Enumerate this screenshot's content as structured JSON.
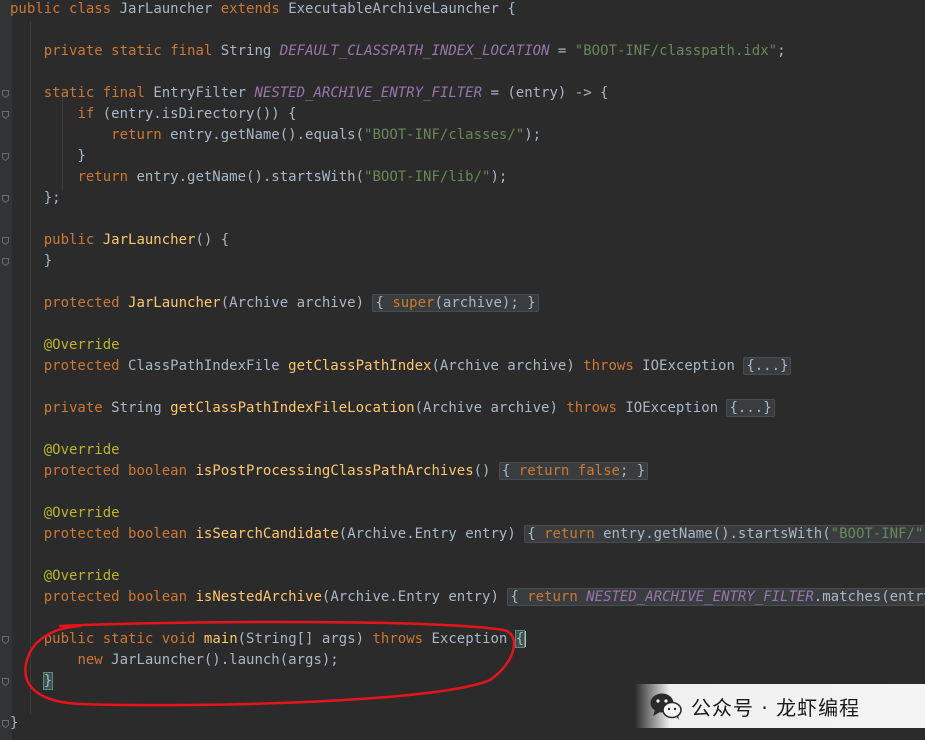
{
  "editor": {
    "background": "#2b2b2b",
    "lines": [
      "public class JarLauncher extends ExecutableArchiveLauncher {",
      "",
      "    private static final String DEFAULT_CLASSPATH_INDEX_LOCATION = \"BOOT-INF/classpath.idx\";",
      "",
      "    static final EntryFilter NESTED_ARCHIVE_ENTRY_FILTER = (entry) -> {",
      "        if (entry.isDirectory()) {",
      "            return entry.getName().equals(\"BOOT-INF/classes/\");",
      "        }",
      "        return entry.getName().startsWith(\"BOOT-INF/lib/\");",
      "    };",
      "",
      "    public JarLauncher() {",
      "    }",
      "",
      "    protected JarLauncher(Archive archive) { super(archive); }",
      "",
      "    @Override",
      "    protected ClassPathIndexFile getClassPathIndex(Archive archive) throws IOException {...}",
      "",
      "    private String getClassPathIndexFileLocation(Archive archive) throws IOException {...}",
      "",
      "    @Override",
      "    protected boolean isPostProcessingClassPathArchives() { return false; }",
      "",
      "    @Override",
      "    protected boolean isSearchCandidate(Archive.Entry entry) { return entry.getName().startsWith(\"BOOT-INF/\"); }",
      "",
      "    @Override",
      "    protected boolean isNestedArchive(Archive.Entry entry) { return NESTED_ARCHIVE_ENTRY_FILTER.matches(entry); }",
      "",
      "    public static void main(String[] args) throws Exception {",
      "        new JarLauncher().launch(args);",
      "    }",
      "",
      "}"
    ]
  },
  "colors": {
    "keyword": "#cc7832",
    "method": "#ffc66d",
    "string": "#6a8759",
    "constant": "#9876aa",
    "annotation": "#bbb529",
    "default_text": "#a9b7c6",
    "highlight_circle": "#e8141b"
  },
  "watermark": {
    "icon": "wechat-icon",
    "text": "公众号 · 龙虾编程"
  }
}
